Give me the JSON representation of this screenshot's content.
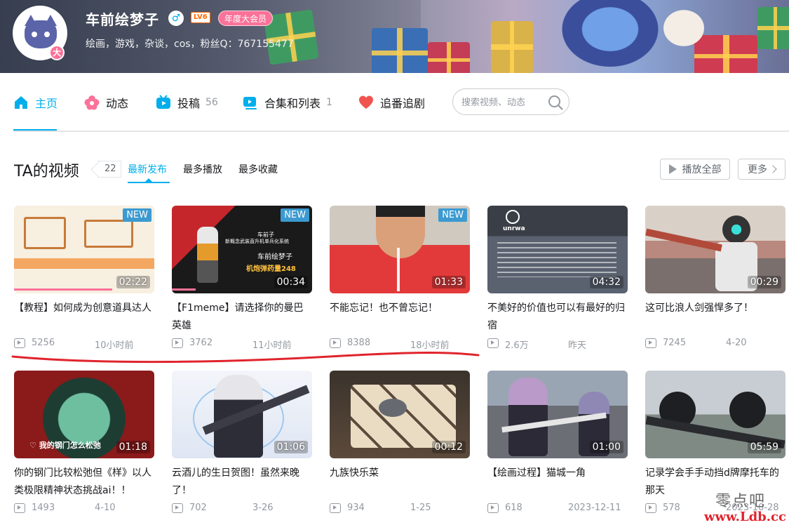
{
  "profile": {
    "name": "车前绘梦子",
    "gender_symbol": "♂",
    "level": "LV6",
    "vip_label": "年度大会员",
    "avatar_badge": "大",
    "sign": "绘画，游戏，杂谈，cos，粉丝Q：767155477"
  },
  "nav": {
    "items": [
      {
        "label": "主页",
        "count": "",
        "icon": "home-icon"
      },
      {
        "label": "动态",
        "count": "",
        "icon": "flower-icon"
      },
      {
        "label": "投稿",
        "count": "56",
        "icon": "tv-icon"
      },
      {
        "label": "合集和列表",
        "count": "1",
        "icon": "playlist-icon"
      },
      {
        "label": "追番追剧",
        "count": "",
        "icon": "heart-icon"
      }
    ],
    "search_placeholder": "搜索视频、动态"
  },
  "section": {
    "title": "TA的视频",
    "count": "22",
    "sort_tabs": [
      "最新发布",
      "最多播放",
      "最多收藏"
    ],
    "play_all": "播放全部",
    "more": "更多"
  },
  "videos": [
    {
      "title": "【教程】如何成为创意道具达人",
      "duration": "02:22",
      "views": "5256",
      "date": "10小时前",
      "badge": "NEW"
    },
    {
      "title": "【F1meme】请选择你的曼巴英雄",
      "duration": "00:34",
      "views": "3762",
      "date": "11小时前",
      "badge": "NEW"
    },
    {
      "title": "不能忘记！也不曾忘记！",
      "duration": "01:33",
      "views": "8388",
      "date": "18小时前",
      "badge": "NEW"
    },
    {
      "title": "不美好的价值也可以有最好的归宿",
      "duration": "04:32",
      "views": "2.6万",
      "date": "昨天",
      "badge": ""
    },
    {
      "title": "这可比浪人剑强悍多了！",
      "duration": "00:29",
      "views": "7245",
      "date": "4-20",
      "badge": ""
    },
    {
      "title": "你的钢门比较松弛但《样》以人类极限精神状态挑战ai！！",
      "duration": "01:18",
      "views": "1493",
      "date": "4-10",
      "badge": ""
    },
    {
      "title": "云酒儿的生日贺图！虽然来晚了！",
      "duration": "01:06",
      "views": "702",
      "date": "3-26",
      "badge": ""
    },
    {
      "title": "九族快乐菜",
      "duration": "00:12",
      "views": "934",
      "date": "1-25",
      "badge": ""
    },
    {
      "title": "【绘画过程】猫城一角",
      "duration": "01:00",
      "views": "618",
      "date": "2023-12-11",
      "badge": ""
    },
    {
      "title": "记录学会手手动挡d牌摩托车的那天",
      "duration": "05:59",
      "views": "578",
      "date": "2023-10-28",
      "badge": ""
    }
  ],
  "thumb_text": {
    "v2_line1": "车前子",
    "v2_line2": "新概念武装直升机单兵化系统",
    "v2_line3": "车前绘梦子",
    "v2_line4": "机炮弹药量248",
    "v4_logo": "unrwa",
    "v6_caption": "♡ 我的钢门怎么松弛"
  },
  "watermark": {
    "line1": "零点吧",
    "line2": "www.Ldb.cc"
  },
  "colors": {
    "accent": "#00aeec",
    "pink": "#fb7299",
    "annotation": "#e0242d"
  }
}
